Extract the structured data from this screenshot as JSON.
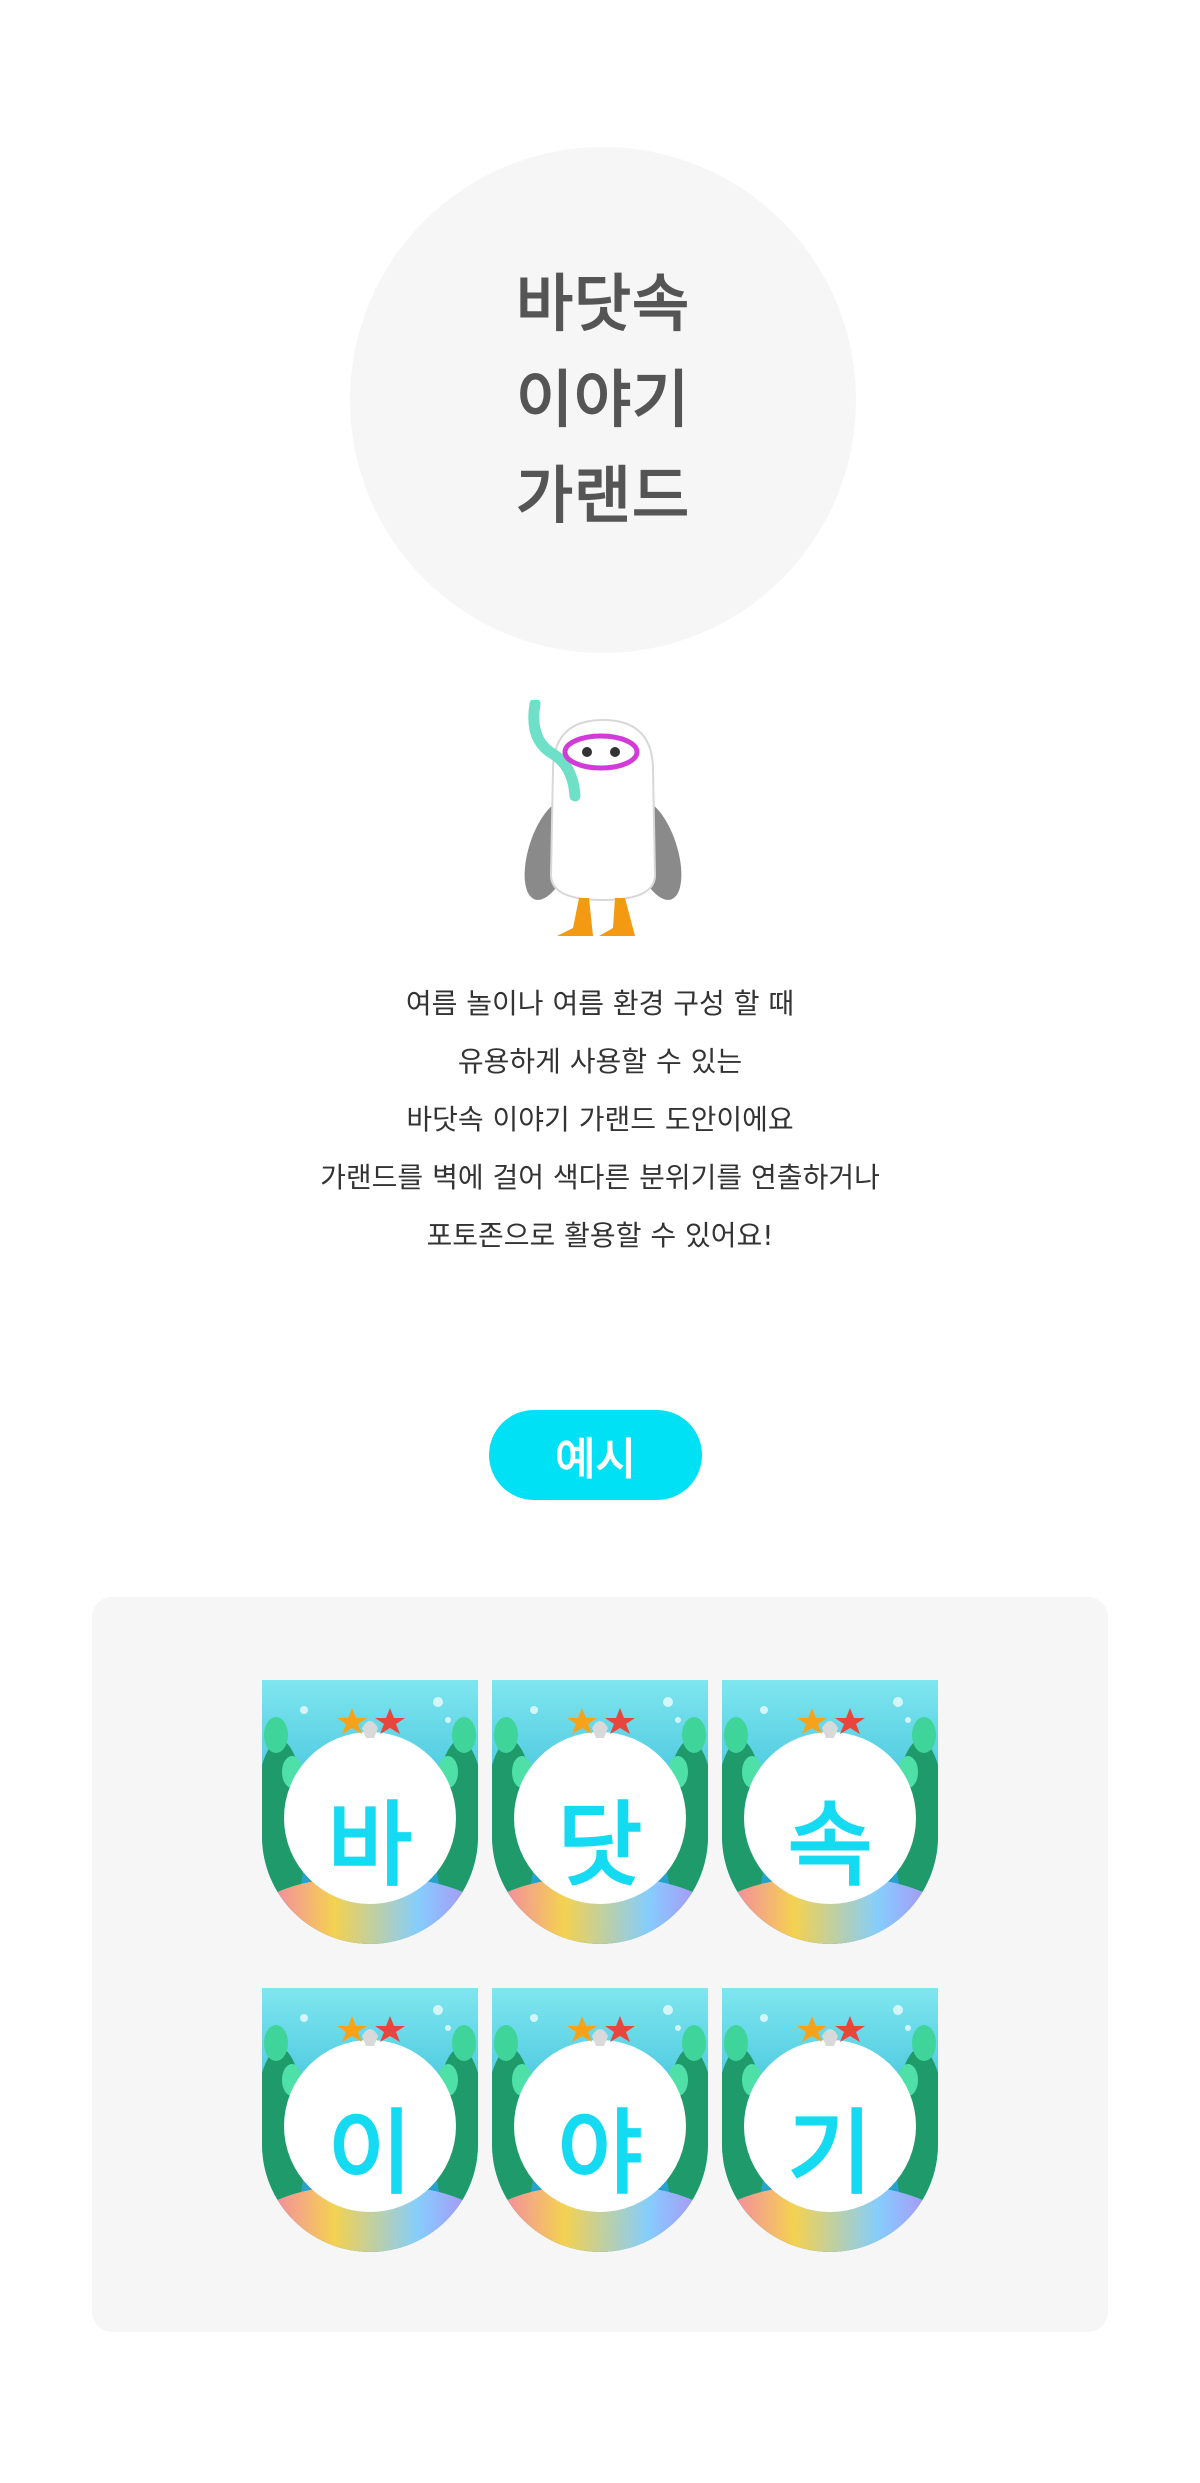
{
  "hero": {
    "title_lines": [
      "바닷속",
      "이야기",
      "가랜드"
    ]
  },
  "description": {
    "lines": [
      "여름 놀이나 여름 환경 구성 할 때",
      "유용하게 사용할 수 있는",
      "바닷속 이야기 가랜드 도안이에요",
      "가랜드를 벽에 걸어 색다른 분위기를 연출하거나",
      "포토존으로 활용할 수 있어요!"
    ]
  },
  "example": {
    "badge_label": "예시",
    "flags": [
      {
        "char": "바"
      },
      {
        "char": "닷"
      },
      {
        "char": "속"
      },
      {
        "char": "이"
      },
      {
        "char": "야"
      },
      {
        "char": "기"
      }
    ]
  },
  "colors": {
    "accent": "#00e1f5",
    "flag_text": "#14dbf2",
    "circle_bg": "#f6f6f6",
    "panel_bg": "#f6f6f6",
    "title_text": "#555555"
  },
  "icons": [
    "seagull-snorkel-mascot",
    "starfish-icon",
    "seashell-icon",
    "seaweed-icon",
    "coral-icon"
  ]
}
